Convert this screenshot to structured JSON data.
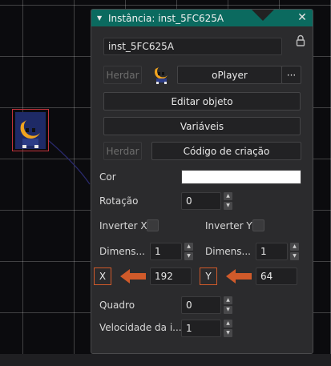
{
  "panel": {
    "title": "Instância: inst_5FC625A",
    "instance_name": "inst_5FC625A",
    "inherit_label": "Herdar",
    "object_name": "oPlayer",
    "more_label": "···",
    "edit_object_label": "Editar objeto",
    "variables_label": "Variáveis",
    "creation_code_label": "Código de criação",
    "color_label": "Cor",
    "color_value": "#ffffff",
    "rotation_label": "Rotação",
    "rotation_value": "0",
    "flip_x_label": "Inverter X",
    "flip_y_label": "Inverter Y",
    "scale_x_label": "Dimens...",
    "scale_x_value": "1",
    "scale_y_label": "Dimens...",
    "scale_y_value": "1",
    "x_label": "X",
    "x_value": "192",
    "y_label": "Y",
    "y_value": "64",
    "frame_label": "Quadro",
    "frame_value": "0",
    "speed_label": "Velocidade da i...",
    "speed_value": "1"
  },
  "icons": {
    "collapse": "triangle-down-icon",
    "close": "close-icon",
    "lock": "lock-icon",
    "arrow": "arrow-left-icon"
  },
  "colors": {
    "title_bar": "#0b6a5f",
    "highlight": "#d05a2a",
    "selection": "#c2323a"
  }
}
